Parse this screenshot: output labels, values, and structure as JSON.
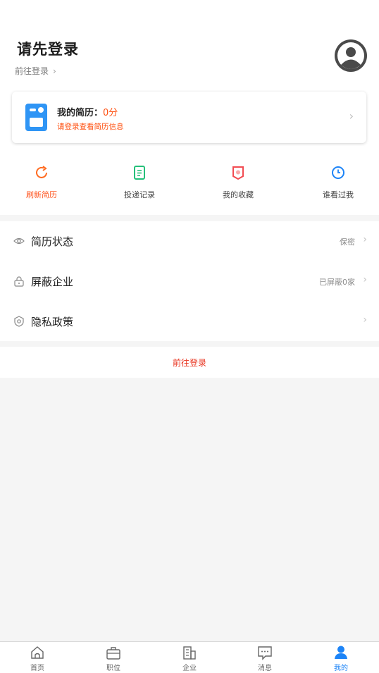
{
  "header": {
    "title": "请先登录",
    "login_link": "前往登录",
    "link_chevron": "›"
  },
  "resume_card": {
    "title": "我的简历：",
    "score": "0分",
    "subtitle": "请登录查看简历信息",
    "chevron": "›",
    "icon": "resume-icon"
  },
  "quick_actions": [
    {
      "label": "刷新简历",
      "icon": "refresh-icon",
      "color": "#ff6a1f",
      "active": true
    },
    {
      "label": "投递记录",
      "icon": "document-list-icon",
      "color": "#25c07a",
      "active": false
    },
    {
      "label": "我的收藏",
      "icon": "bookmark-icon",
      "color": "#f24c52",
      "active": false
    },
    {
      "label": "谁看过我",
      "icon": "clock-icon",
      "color": "#1d84f7",
      "active": false
    }
  ],
  "settings": [
    {
      "label": "简历状态",
      "value": "保密",
      "icon": "eye-icon",
      "chevron": "›"
    },
    {
      "label": "屏蔽企业",
      "value": "已屏蔽0家",
      "icon": "lock-icon",
      "chevron": "›"
    },
    {
      "label": "隐私政策",
      "value": "",
      "icon": "shield-icon",
      "chevron": "›"
    }
  ],
  "login_button": "前往登录",
  "tabbar": [
    {
      "label": "首页",
      "icon": "home-icon",
      "active": false
    },
    {
      "label": "职位",
      "icon": "briefcase-icon",
      "active": false
    },
    {
      "label": "企业",
      "icon": "building-icon",
      "active": false
    },
    {
      "label": "消息",
      "icon": "chat-icon",
      "active": false
    },
    {
      "label": "我的",
      "icon": "user-icon",
      "active": true
    }
  ],
  "colors": {
    "accent_orange": "#ff4f0f",
    "login_red": "#e8321e",
    "tab_active": "#1d84f7"
  }
}
